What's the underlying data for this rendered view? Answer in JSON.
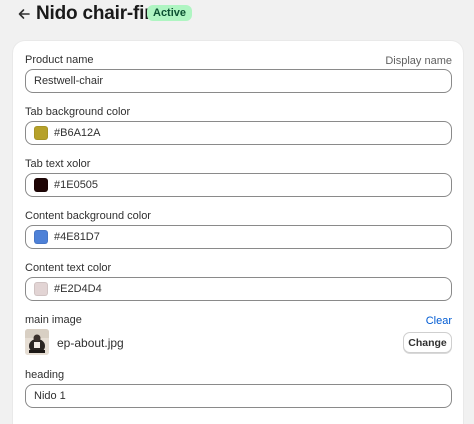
{
  "header": {
    "back_icon": "arrow-left-icon",
    "title": "Nido chair-first",
    "status": "Active",
    "status_color": "#aff5c2"
  },
  "fields": {
    "product_name": {
      "label": "Product name",
      "side_label": "Display name",
      "value": "Restwell-chair"
    },
    "tab_bg_color": {
      "label": "Tab background color",
      "value": "#B6A12A",
      "swatch": "#B6A12A"
    },
    "tab_text_color": {
      "label": "Tab text xolor",
      "value": "#1E0505",
      "swatch": "#1E0505"
    },
    "content_bg_color": {
      "label": "Content background color",
      "value": "#4E81D7",
      "swatch": "#4E81D7"
    },
    "content_text_color": {
      "label": "Content text color",
      "value": "#E2D4D4",
      "swatch": "#E2D4D4"
    },
    "main_image": {
      "label": "main image",
      "clear_label": "Clear",
      "file_name": "ep-about.jpg",
      "change_label": "Change"
    },
    "heading": {
      "label": "heading",
      "value": "Nido 1"
    }
  }
}
